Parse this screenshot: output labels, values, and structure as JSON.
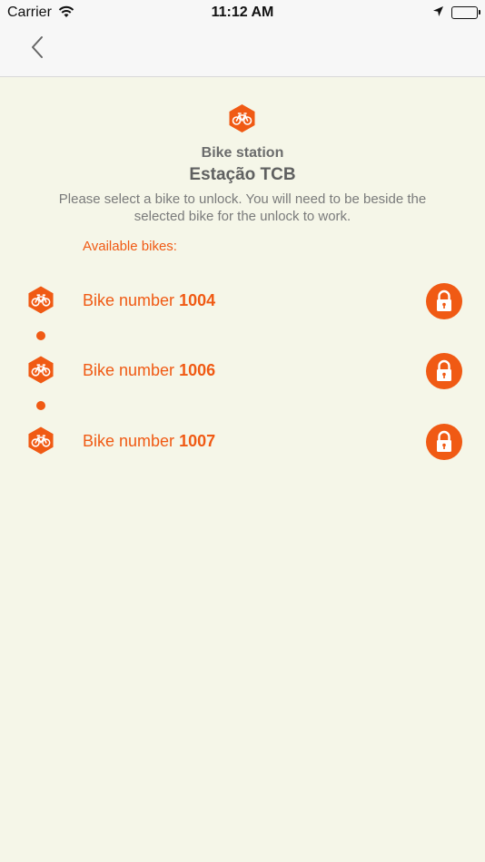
{
  "status_bar": {
    "carrier": "Carrier",
    "time": "11:12 AM"
  },
  "nav": {
    "back_icon": "chevron-left-icon"
  },
  "station": {
    "label": "Bike station",
    "name": "Estação TCB",
    "instructions": "Please select a bike to unlock. You will need to be beside the selected bike for the unlock to work.",
    "available_label": "Available bikes:"
  },
  "bikes": [
    {
      "label": "Bike number ",
      "number": "1004"
    },
    {
      "label": "Bike number ",
      "number": "1006"
    },
    {
      "label": "Bike number ",
      "number": "1007"
    }
  ],
  "colors": {
    "accent": "#f05a14",
    "background": "#f5f6e8"
  }
}
